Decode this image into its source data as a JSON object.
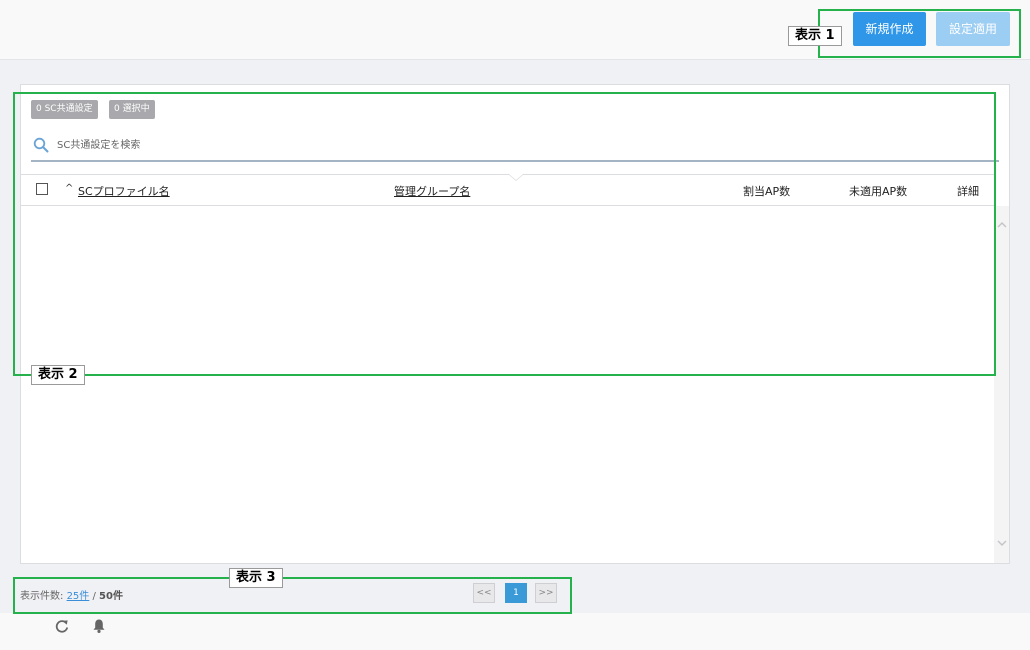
{
  "header": {
    "new_button": "新規作成",
    "apply_button": "設定適用"
  },
  "badges": {
    "common_count": "0 SC共通設定",
    "selected_count": "0 選択中"
  },
  "search": {
    "placeholder": "SC共通設定を検索",
    "value": ""
  },
  "table": {
    "sort_indicator": "^",
    "columns": [
      "SCプロファイル名",
      "管理グループ名",
      "割当AP数",
      "未適用AP数",
      "詳細"
    ],
    "rows": []
  },
  "footer": {
    "label": "表示件数:",
    "page_size": "25件",
    "separator": "/",
    "total": "50件",
    "pagination": {
      "prev": "<<",
      "current": "1",
      "next": ">>"
    }
  },
  "annotations": {
    "label_1": "表示 1",
    "label_2": "表示 2",
    "label_3": "表示 3"
  },
  "icons": [
    "search-icon",
    "sort-asc-icon",
    "chevron-up-icon",
    "chevron-down-icon",
    "refresh-icon",
    "bell-icon"
  ],
  "colors": {
    "primary": "#2f96e8",
    "primary_disabled": "#9ccdf3",
    "annotation": "#25b14b",
    "badge": "#a9a9ad",
    "link": "#3a8ed8"
  }
}
